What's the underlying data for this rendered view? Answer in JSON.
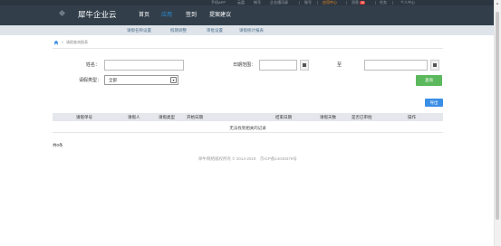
{
  "topbar": {
    "items": [
      "手机APP",
      "云盘",
      "帐号",
      "企业通讯录",
      "账号",
      "应用中心",
      "消息",
      "任务",
      "个人中心"
    ],
    "message_count": "10"
  },
  "nav": {
    "brand": "犀牛企业云",
    "items": [
      "首页",
      "应用",
      "签到",
      "提案建议"
    ]
  },
  "subnav": {
    "items": [
      "请假名称设置",
      "假期调整",
      "审批设置",
      "请假统计报表"
    ]
  },
  "breadcrumb": {
    "text": "请假查询报表"
  },
  "form": {
    "name_label": "姓名：",
    "date_range_label": "日期范围：",
    "to_label": "至",
    "leave_type_label": "请假类型：",
    "leave_type_value": "全部",
    "query_button": "查询",
    "export_button": "导出"
  },
  "table": {
    "headers": [
      "请假单号",
      "请假人",
      "请假类型",
      "开始日期",
      "结束日期",
      "请假天数",
      "是否已审批",
      "操作"
    ],
    "empty_text": "无法找到相关的记录"
  },
  "summary": {
    "total": "共0条"
  },
  "footer": {
    "text": "犀牛网络版权所有 © 2014-2019　京ICP备14049379号"
  }
}
